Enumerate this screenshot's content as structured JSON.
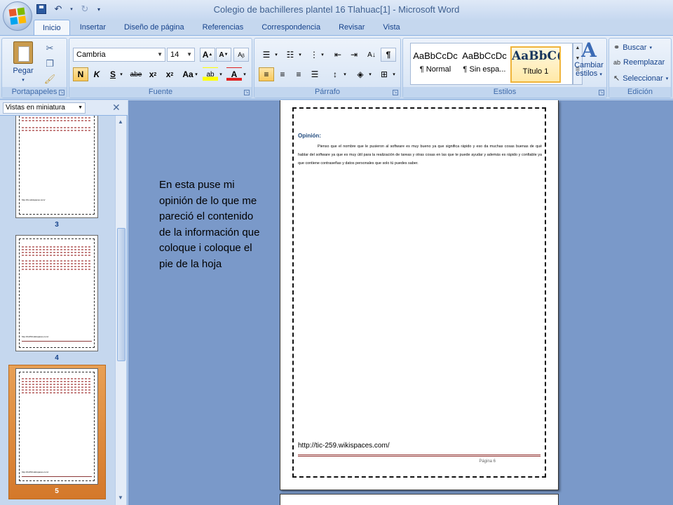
{
  "window": {
    "title": "Colegio de bachilleres plantel 16 Tlahuac[1] - Microsoft Word"
  },
  "tabs": [
    "Inicio",
    "Insertar",
    "Diseño de página",
    "Referencias",
    "Correspondencia",
    "Revisar",
    "Vista"
  ],
  "ribbon": {
    "clipboard": {
      "paste_label": "Pegar",
      "group_label": "Portapapeles"
    },
    "font": {
      "font_name": "Cambria",
      "font_size": "14",
      "group_label": "Fuente"
    },
    "paragraph": {
      "group_label": "Párrafo"
    },
    "styles": {
      "items": [
        {
          "sample": "AaBbCcDc",
          "name": "¶ Normal"
        },
        {
          "sample": "AaBbCcDc",
          "name": "¶ Sin espa..."
        },
        {
          "sample": "AaBbC(",
          "name": "Título 1"
        }
      ],
      "change_label_1": "Cambiar",
      "change_label_2": "estilos",
      "group_label": "Estilos"
    },
    "editing": {
      "find": "Buscar",
      "replace": "Reemplazar",
      "select": "Seleccionar",
      "group_label": "Edición"
    }
  },
  "thumbnails": {
    "view_label": "Vistas en miniatura",
    "pages": [
      {
        "number": "3",
        "url": "http://tic-wikispaces.com/"
      },
      {
        "number": "4",
        "url": "http://tic259.wikispaces.com/"
      },
      {
        "number": "5",
        "url": "http://tic259.wikispaces.com/"
      }
    ]
  },
  "document": {
    "heading": "Opinión:",
    "body": "Pienso que el nombre que le pusieron al software es muy bueno ya que significa rápido y eso da muchas cosas buenas de qué hablar del software ya que es muy útil para la realización de tareas y otras cosas en las que te puede ayudar y además es rápido y confiable ya que contiene contraseñas y datos personales que solo tú puedes saber.",
    "url": "http://tic-259.wikispaces.com/",
    "page_label": "Página 6"
  },
  "annotation": "En esta puse mi opinión de lo que me pareció el contenido de la información que coloque i coloque el pie de la hoja"
}
